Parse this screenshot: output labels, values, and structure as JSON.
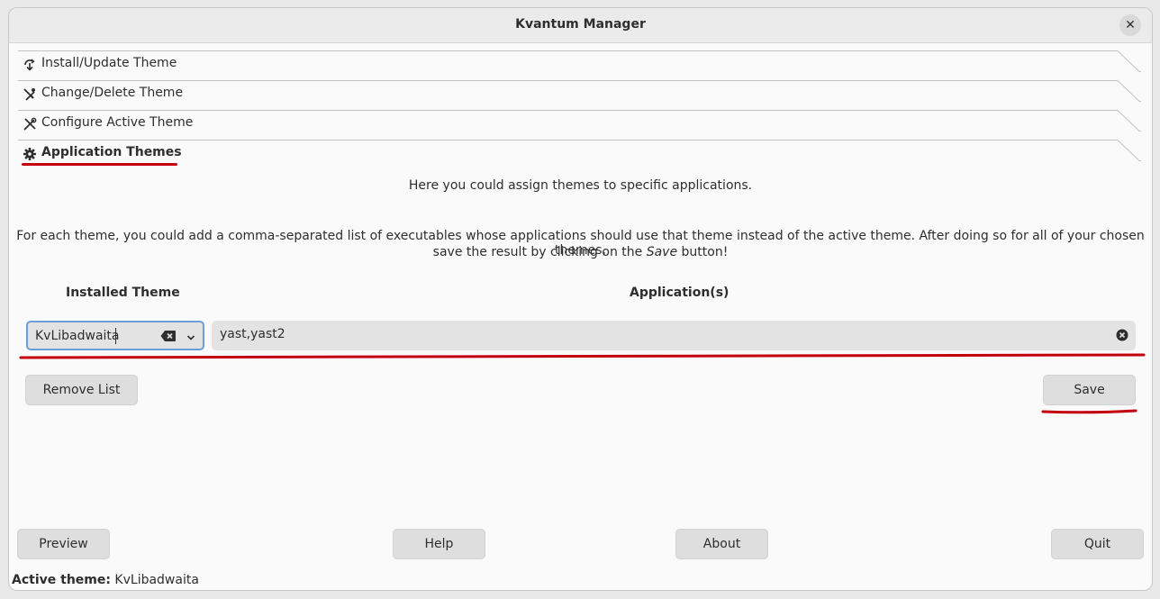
{
  "window": {
    "title": "Kvantum Manager"
  },
  "tabs": [
    {
      "label": "Install/Update Theme",
      "icon": "install-icon"
    },
    {
      "label": "Change/Delete Theme",
      "icon": "change-delete-icon"
    },
    {
      "label": "Configure Active Theme",
      "icon": "configure-icon"
    },
    {
      "label": "Application Themes",
      "icon": "gear-icon",
      "active": true
    }
  ],
  "app_themes": {
    "intro": "Here you could assign themes to specific applications.",
    "desc_line1": "For each theme, you could add a comma-separated list of executables whose applications should use that theme instead of the active theme. After doing so for all of your chosen themes,",
    "desc_line2_pre": "save the result by clicking on the ",
    "desc_line2_em": "Save",
    "desc_line2_post": " button!",
    "installed_theme_header": "Installed Theme",
    "applications_header": "Application(s)",
    "theme_value": "KvLibadwaita",
    "applications_value": "yast,yast2",
    "remove_list_label": "Remove List",
    "save_label": "Save"
  },
  "bottom": {
    "preview_label": "Preview",
    "help_label": "Help",
    "about_label": "About",
    "quit_label": "Quit"
  },
  "status": {
    "label": "Active theme:",
    "value": "KvLibadwaita"
  },
  "colors": {
    "annotation_red": "#c4000d",
    "focus_blue": "#6b9fd8"
  }
}
